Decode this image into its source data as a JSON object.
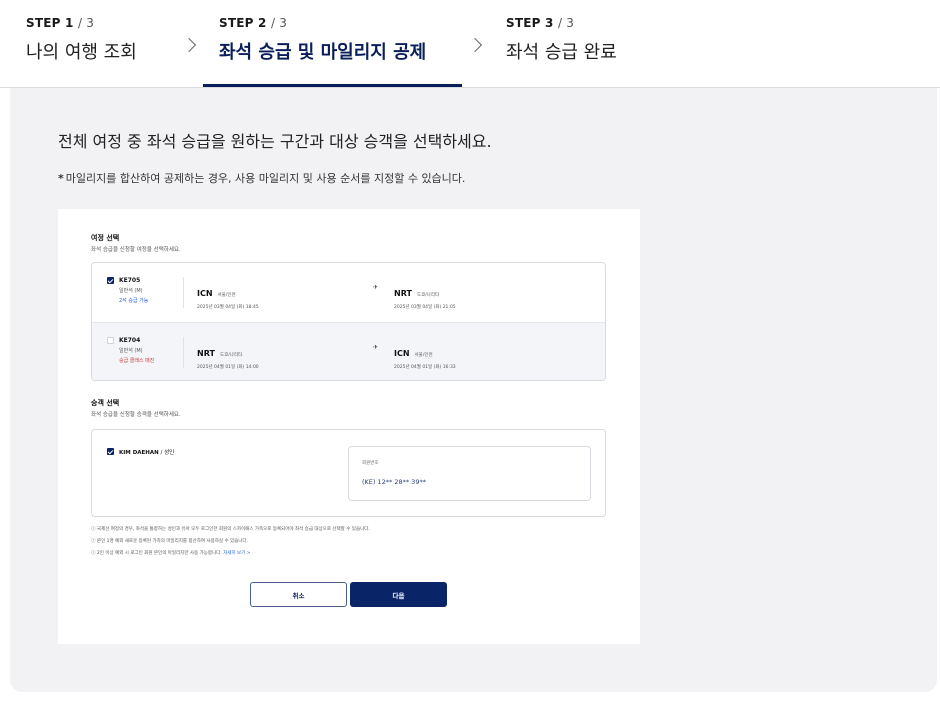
{
  "stepper": {
    "steps": [
      {
        "label": "STEP",
        "num": "1",
        "total": "/ 3",
        "name": "나의 여행 조회"
      },
      {
        "label": "STEP",
        "num": "2",
        "total": "/ 3",
        "name": "좌석 승급 및 마일리지 공제"
      },
      {
        "label": "STEP",
        "num": "3",
        "total": "/ 3",
        "name": "좌석 승급 완료"
      }
    ]
  },
  "main": {
    "headline": "전체 여정 중 좌석 승급을 원하는 구간과 대상 승객을 선택하세요.",
    "note_star": "*",
    "note": "마일리지를 합산하여 공제하는 경우, 사용 마일리지 및 사용 순서를 지정할 수 있습니다."
  },
  "itinerary": {
    "title": "여정 선택",
    "subtitle": "좌석 승급을 신청할 여정을 선택하세요.",
    "flights": [
      {
        "checked": true,
        "flight_no": "KE705",
        "cabin": "일반석 (M)",
        "status": "2석 승급 가능",
        "dep_code": "ICN",
        "dep_city": "서울/인천",
        "dep_time": "2025년 03월 04일 (화) 18:45",
        "arr_code": "NRT",
        "arr_city": "도쿄/나리타",
        "arr_time": "2025년 03월 04일 (화) 21:05"
      },
      {
        "checked": false,
        "flight_no": "KE704",
        "cabin": "일반석 (M)",
        "status": "승급 클래스 매진",
        "dep_code": "NRT",
        "dep_city": "도쿄/나리타",
        "dep_time": "2025년 04월 01일 (화) 14:00",
        "arr_code": "ICN",
        "arr_city": "서울/인천",
        "arr_time": "2025년 04월 01일 (화) 16:33"
      }
    ]
  },
  "passengers": {
    "title": "승객 선택",
    "subtitle": "좌석 승급을 신청할 승객을 선택하세요.",
    "list": [
      {
        "name": "KIM DAEHAN",
        "type": "/ 성인",
        "member_label": "회원번호",
        "member_no": "(KE) 12** 28** 39**"
      }
    ]
  },
  "info_notes": [
    {
      "text": "ⓘ 국제선 여정의 경우, 좌석을 통합하는 성인과 유아 모두 로그인한 회원의 스카이패스 가족으로 등록되어야 좌석 승급 대상으로 선택할 수 있습니다.",
      "link": ""
    },
    {
      "text": "ⓘ 본인 1명 예외 새로운 등록된 가족의 마일리지를 합산하여 사용하실 수 있습니다.",
      "link": ""
    },
    {
      "text": "ⓘ 2인 이상 예외 시 로그인 회원 본인의 마일리지만 사용 가능합니다.",
      "link": "자세히 보기 >"
    }
  ],
  "buttons": {
    "cancel": "취소",
    "next": "다음"
  },
  "colors": {
    "primary": "#0a2468",
    "accent_blue": "#1f5fd8",
    "alert_red": "#d03a3a",
    "panel_bg": "#f2f2f4"
  }
}
